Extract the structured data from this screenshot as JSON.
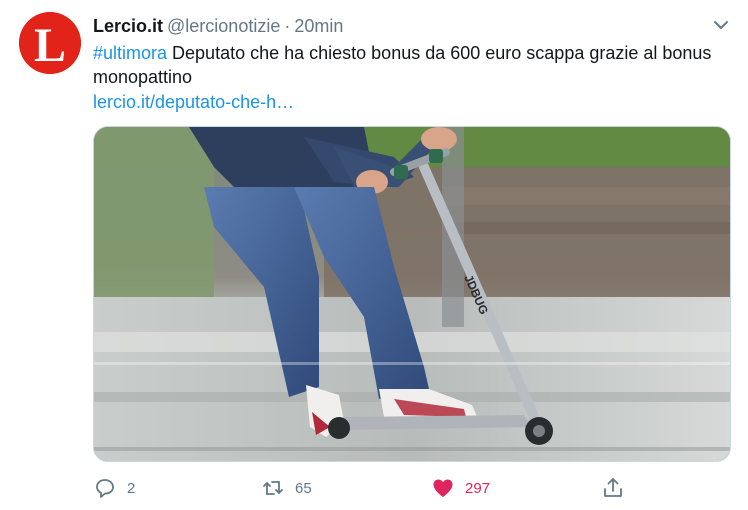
{
  "account": {
    "name": "Lercio.it",
    "handle": "@lercionotizie",
    "separator": "·",
    "time": "20min",
    "avatar_letter": "L"
  },
  "tweet": {
    "hashtag": "#ultimora",
    "text": " Deputato che ha chiesto bonus da 600 euro scappa grazie al bonus monopattino",
    "link": "lercio.it/deputato-che-h…"
  },
  "media": {
    "scooter_brand": "JDBUG"
  },
  "actions": {
    "reply_count": "2",
    "retweet_count": "65",
    "like_count": "297"
  },
  "colors": {
    "accent": "#1b95e0",
    "like": "#e0245e",
    "muted": "#657786",
    "brand": "#e2231a"
  },
  "icons": [
    "chevron-down-icon",
    "reply-icon",
    "retweet-icon",
    "heart-icon",
    "share-icon"
  ]
}
